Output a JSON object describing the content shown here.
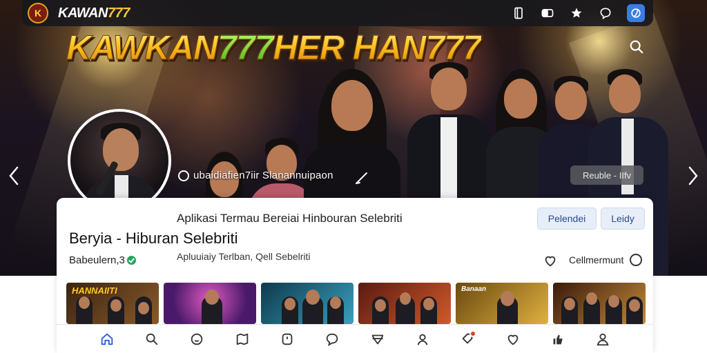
{
  "topbar": {
    "logo_text": "K",
    "brand_name": "KAWAN",
    "brand_number": "777",
    "icons": [
      "tablet-icon",
      "card-icon",
      "star-badge-icon",
      "chat-bubble-icon",
      "globe-app-icon"
    ]
  },
  "hero": {
    "marquee_part1": "KAWKAN",
    "marquee_part2": "777",
    "marquee_part3": "HER HAN777",
    "caption": "ubaidiafien7iir Slanannuipaon",
    "pill_label": "Reuble - IIfv"
  },
  "profile": {
    "tagline": "Aplikasi Termau Bereiai Hinbouran Selebriti",
    "title": "Beryia - Hiburan Selebriti",
    "subtitle": "Apluuiaiy Terlban, Qell Sebelriti",
    "handle": "Babeulern,3",
    "button_primary": "Pelendei",
    "button_secondary": "Leidy",
    "comment_label": "Cellmermunt"
  },
  "thumbnails": [
    {
      "label": "HANNAIITI",
      "colors": [
        "#3a2412",
        "#8a5a2a"
      ]
    },
    {
      "label": "",
      "colors": [
        "#4a1a6a",
        "#c03aa0"
      ]
    },
    {
      "label": "",
      "colors": [
        "#0e3a4a",
        "#3aa0c0"
      ]
    },
    {
      "label": "",
      "colors": [
        "#5a1a12",
        "#d05a2a"
      ]
    },
    {
      "label": "Banaan",
      "colors": [
        "#6a4a10",
        "#e0b040"
      ]
    },
    {
      "label": "",
      "colors": [
        "#3a1a0a",
        "#c08a3a"
      ]
    }
  ],
  "bottom_nav": [
    "home-icon",
    "search-icon",
    "smile-chat-icon",
    "bookmark-flag-icon",
    "shield-icon",
    "message-icon",
    "tag-icon",
    "user-pin-icon",
    "notification-icon",
    "heart-icon",
    "thumb-up-icon",
    "profile-icon"
  ],
  "colors": {
    "accent_gold": "#ffc21f",
    "topbar_bg": "#18181c",
    "button_bg": "#e7eef9",
    "verified_green": "#22a55a"
  }
}
